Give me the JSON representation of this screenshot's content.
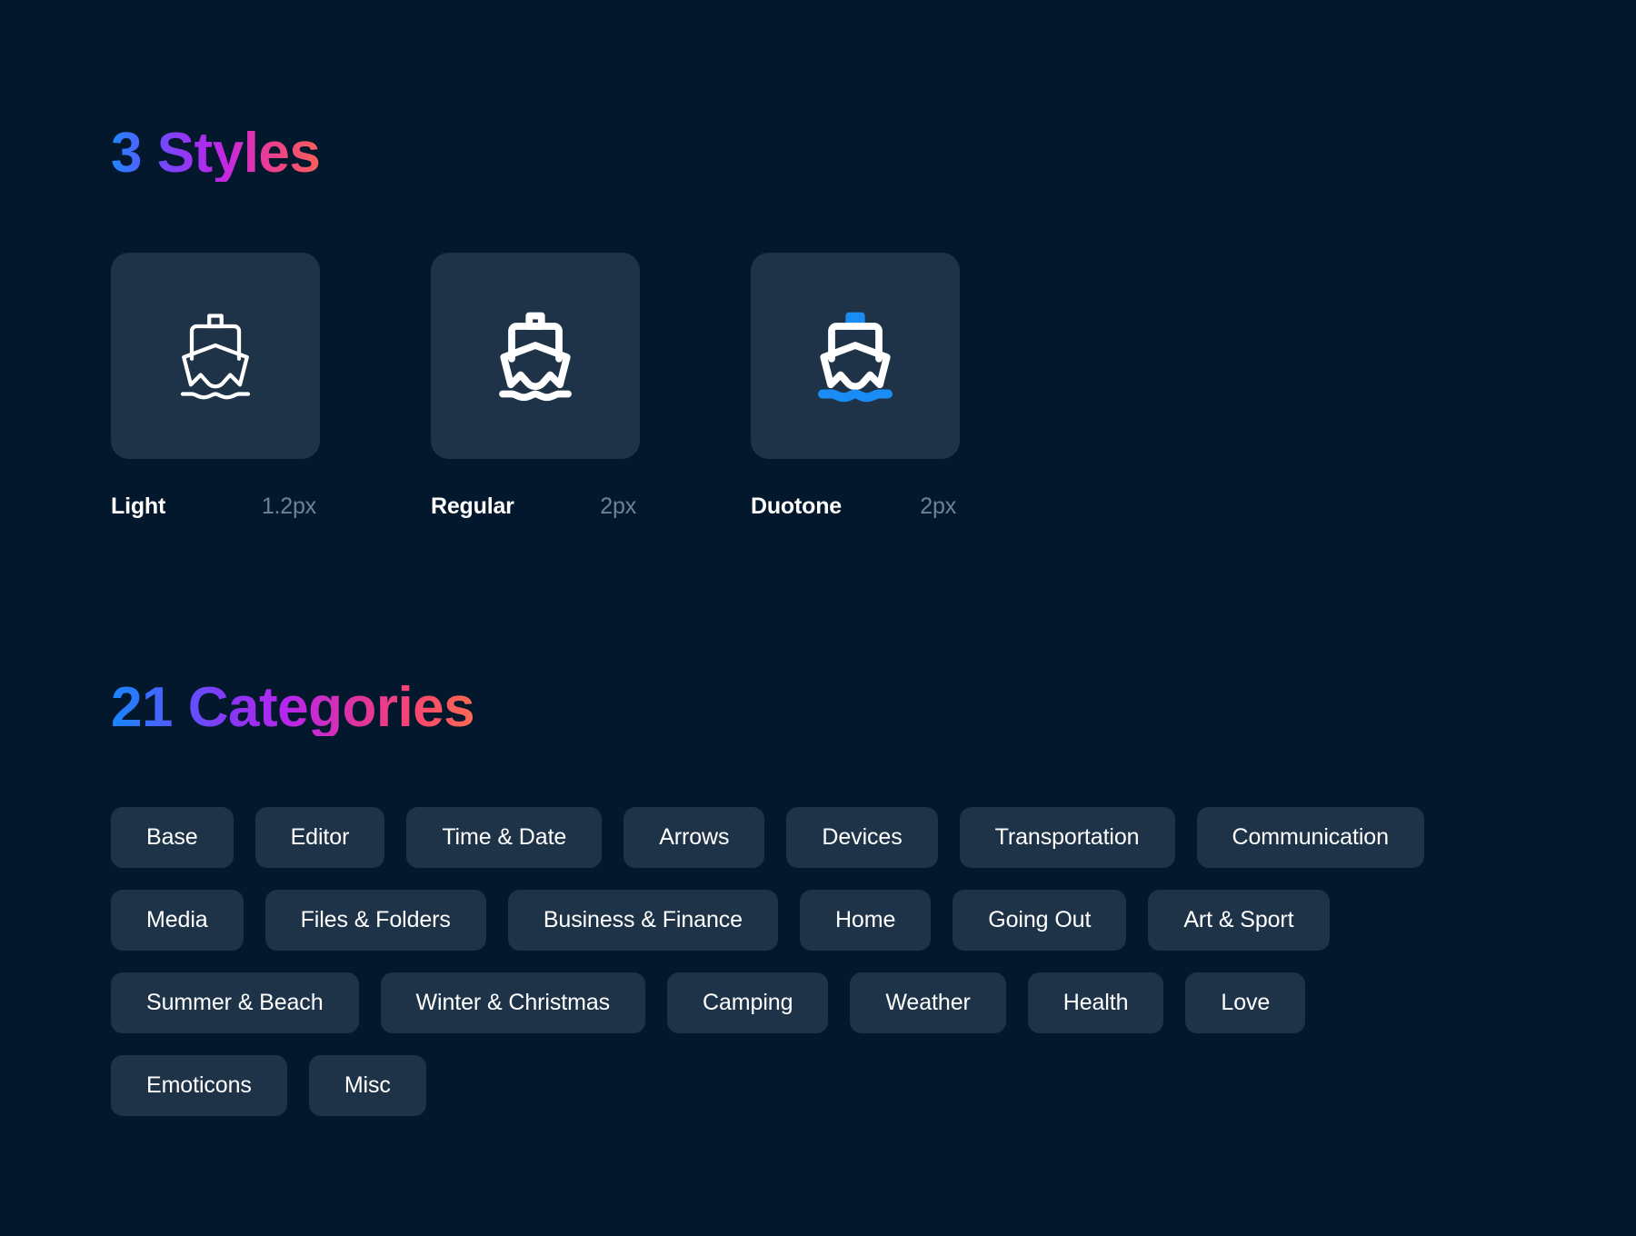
{
  "theme": {
    "page_background": "#04182d",
    "surface": "#1e3348",
    "text_primary": "#ffffff",
    "text_muted": "#6e8196",
    "accent_blue": "#1a8cf5",
    "gradient_start": "#1e88ff",
    "gradient_mid": "#a62ef0",
    "gradient_end": "#fb6058"
  },
  "styles_section": {
    "heading": "3 Styles",
    "items": [
      {
        "name": "Light",
        "weight": "1.2px",
        "icon": "ship-icon",
        "variant": "light"
      },
      {
        "name": "Regular",
        "weight": "2px",
        "icon": "ship-icon",
        "variant": "regular"
      },
      {
        "name": "Duotone",
        "weight": "2px",
        "icon": "ship-icon",
        "variant": "duotone"
      }
    ]
  },
  "categories_section": {
    "heading": "21 Categories",
    "items": [
      {
        "label": "Base"
      },
      {
        "label": "Editor"
      },
      {
        "label": "Time & Date"
      },
      {
        "label": "Arrows"
      },
      {
        "label": "Devices"
      },
      {
        "label": "Transportation"
      },
      {
        "label": "Communication"
      },
      {
        "label": "Media"
      },
      {
        "label": "Files & Folders"
      },
      {
        "label": "Business & Finance"
      },
      {
        "label": "Home"
      },
      {
        "label": "Going Out"
      },
      {
        "label": "Art & Sport"
      },
      {
        "label": "Summer & Beach"
      },
      {
        "label": "Winter & Christmas"
      },
      {
        "label": "Camping"
      },
      {
        "label": "Weather"
      },
      {
        "label": "Health"
      },
      {
        "label": "Love"
      },
      {
        "label": "Emoticons"
      },
      {
        "label": "Misc"
      }
    ]
  }
}
